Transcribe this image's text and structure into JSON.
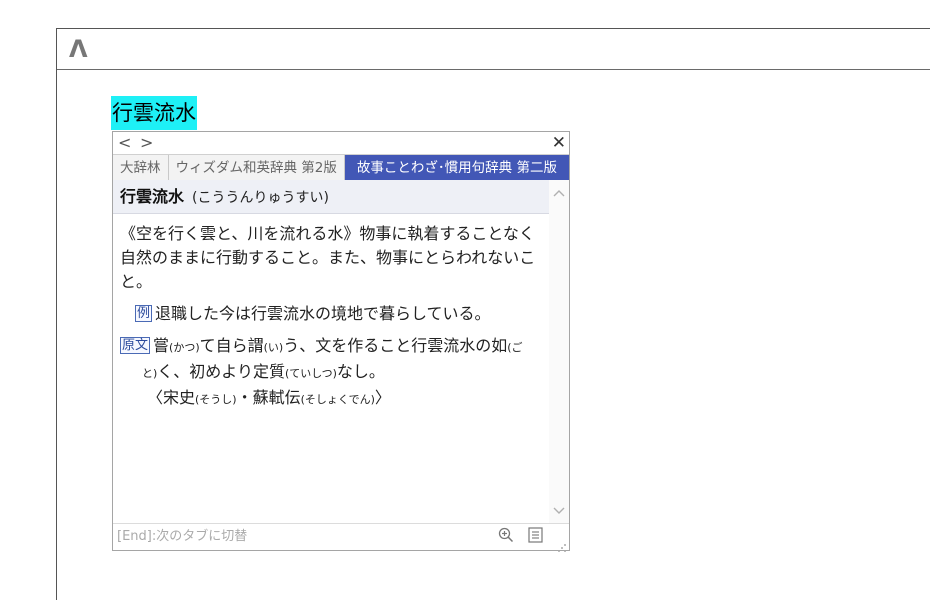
{
  "editor": {
    "logo_glyph": "Λ"
  },
  "selection": {
    "text": "行雲流水"
  },
  "popup": {
    "nav": {
      "back": "<",
      "forward": ">",
      "close": "✕"
    },
    "tabs": [
      {
        "label": "大辞林"
      },
      {
        "label": "ウィズダム和英辞典 第2版"
      },
      {
        "label": "故事ことわざ･慣用句辞典 第二版"
      }
    ],
    "active_tab_index": 2,
    "entry": {
      "headword": "行雲流水",
      "reading": "(こううんりゅうすい)",
      "definition": "《空を行く雲と、川を流れる水》物事に執着することなく自然のままに行動すること。また、物事にとらわれないこと。",
      "example_badge": "例",
      "example": "退職した今は行雲流水の境地で暮らしている。",
      "source_badge": "原文",
      "source_line1_a": "嘗",
      "source_ruby1": "(かつ)",
      "source_line1_b": "て自ら謂",
      "source_ruby2": "(い)",
      "source_line1_c": "う、文を作ること行雲流水の如",
      "source_ruby3": "(ご",
      "source_ruby3b": "と)",
      "source_line2_a": "く、初めより定質",
      "source_ruby4": "(ていしつ)",
      "source_line2_b": "なし。",
      "source_line3_a": "〈宋史",
      "source_ruby5": "(そうし)",
      "source_line3_b": "・蘇軾伝",
      "source_ruby6": "(そしょくでん)",
      "source_line3_c": "〉"
    },
    "status": {
      "hint": "[End]:次のタブに切替",
      "zoom_icon": "zoom-in-icon",
      "list_icon": "list-icon"
    }
  },
  "colors": {
    "selection_highlight": "#1ef0f6",
    "active_tab": "#4257b6",
    "headword_bar": "#eef0f6"
  }
}
